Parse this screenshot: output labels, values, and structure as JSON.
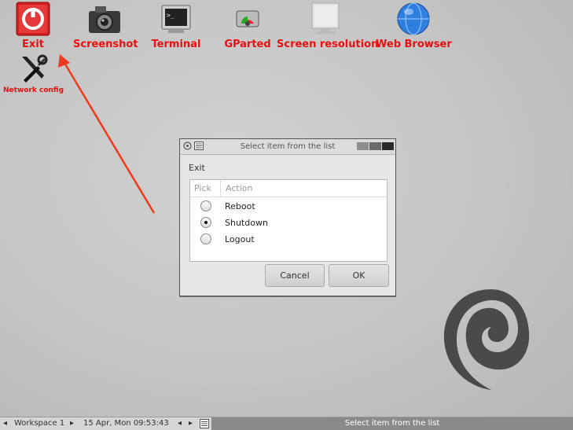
{
  "desktop": {
    "icons": [
      {
        "label": "Exit"
      },
      {
        "label": "Screenshot"
      },
      {
        "label": "Terminal"
      },
      {
        "label": "GParted"
      },
      {
        "label": "Screen resolution"
      },
      {
        "label": "Web Browser"
      },
      {
        "label": "Network config"
      }
    ]
  },
  "dialog": {
    "title": "Select item from the list",
    "heading": "Exit",
    "columns": {
      "pick": "Pick",
      "action": "Action"
    },
    "options": [
      {
        "label": "Reboot",
        "selected": false
      },
      {
        "label": "Shutdown",
        "selected": true
      },
      {
        "label": "Logout",
        "selected": false
      }
    ],
    "cancel_label": "Cancel",
    "ok_label": "OK"
  },
  "taskbar": {
    "workspace": "Workspace 1",
    "datetime": "15 Apr, Mon 09:53:43",
    "active_task": "Select item from the list"
  },
  "colors": {
    "icon_label": "#e81010",
    "arrow": "#ee3b1c"
  }
}
